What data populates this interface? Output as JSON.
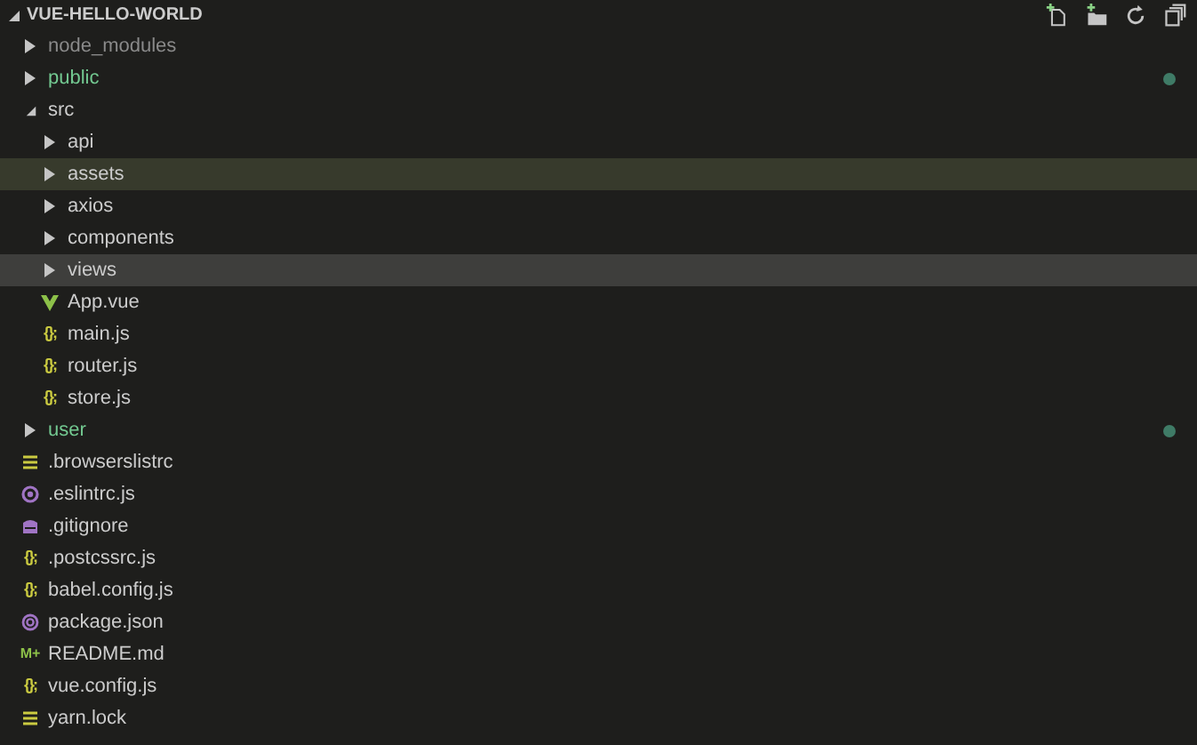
{
  "explorer": {
    "title": "VUE-HELLO-WORLD"
  },
  "tree": [
    {
      "kind": "folder",
      "name": "node_modules",
      "expanded": false,
      "ignored": true,
      "untracked": false,
      "selected": false,
      "hovered": false
    },
    {
      "kind": "folder",
      "name": "public",
      "expanded": false,
      "ignored": false,
      "untracked": true,
      "selected": false,
      "hovered": false
    },
    {
      "kind": "folder",
      "name": "src",
      "expanded": true,
      "ignored": false,
      "untracked": false,
      "selected": false,
      "hovered": false,
      "children": [
        {
          "kind": "folder",
          "name": "api",
          "expanded": false,
          "ignored": false,
          "untracked": false,
          "selected": false,
          "hovered": false
        },
        {
          "kind": "folder",
          "name": "assets",
          "expanded": false,
          "ignored": false,
          "untracked": false,
          "selected": false,
          "hovered": true
        },
        {
          "kind": "folder",
          "name": "axios",
          "expanded": false,
          "ignored": false,
          "untracked": false,
          "selected": false,
          "hovered": false
        },
        {
          "kind": "folder",
          "name": "components",
          "expanded": false,
          "ignored": false,
          "untracked": false,
          "selected": false,
          "hovered": false
        },
        {
          "kind": "folder",
          "name": "views",
          "expanded": false,
          "ignored": false,
          "untracked": false,
          "selected": true,
          "hovered": false
        },
        {
          "kind": "vue",
          "name": "App.vue",
          "selected": false,
          "hovered": false
        },
        {
          "kind": "js",
          "glyph": "{};",
          "name": "main.js",
          "selected": false,
          "hovered": false
        },
        {
          "kind": "js",
          "glyph": "{};",
          "name": "router.js",
          "selected": false,
          "hovered": false
        },
        {
          "kind": "js",
          "glyph": "{};",
          "name": "store.js",
          "selected": false,
          "hovered": false
        }
      ]
    },
    {
      "kind": "folder",
      "name": "user",
      "expanded": false,
      "ignored": false,
      "untracked": true,
      "selected": false,
      "hovered": false
    },
    {
      "kind": "text",
      "name": ".browserslistrc",
      "selected": false,
      "hovered": false
    },
    {
      "kind": "eslint",
      "name": ".eslintrc.js",
      "selected": false,
      "hovered": false
    },
    {
      "kind": "git",
      "name": ".gitignore",
      "selected": false,
      "hovered": false
    },
    {
      "kind": "js",
      "glyph": "{};",
      "name": ".postcssrc.js",
      "selected": false,
      "hovered": false
    },
    {
      "kind": "js",
      "glyph": "{};",
      "name": "babel.config.js",
      "selected": false,
      "hovered": false
    },
    {
      "kind": "package",
      "name": "package.json",
      "selected": false,
      "hovered": false
    },
    {
      "kind": "markdown",
      "glyph": "M+",
      "name": "README.md",
      "selected": false,
      "hovered": false
    },
    {
      "kind": "js",
      "glyph": "{};",
      "name": "vue.config.js",
      "selected": false,
      "hovered": false
    },
    {
      "kind": "text",
      "name": "yarn.lock",
      "selected": false,
      "hovered": false
    }
  ]
}
